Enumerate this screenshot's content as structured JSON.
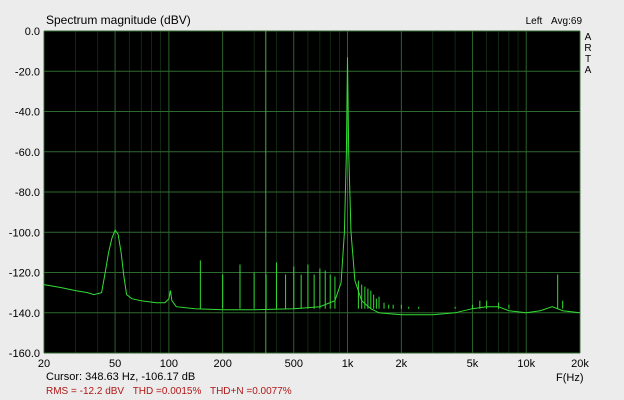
{
  "window": {
    "title": "Spectrum magnitude (dBV)",
    "channel": "Left",
    "averaging": "Avg:69",
    "vertical_label": "ARTA"
  },
  "readouts": {
    "cursor": "Cursor: 348.63 Hz, -106.17 dB",
    "rms": "RMS =  -12.2 dBV",
    "thd": "THD =0.0015%",
    "thdn": "THD+N =0.0077%"
  },
  "colors": {
    "plot_background": "#000000",
    "grid": "#2f6a2f",
    "trace": "#33dd33",
    "cursor_line": "#40b040",
    "rms_text": "#b01818"
  },
  "chart_data": {
    "type": "line",
    "title": "Spectrum magnitude (dBV)",
    "xlabel": "F(Hz)",
    "ylabel": "",
    "x_scale": "log",
    "xlim": [
      20,
      20000
    ],
    "ylim": [
      -160,
      0
    ],
    "grid": true,
    "y_ticks": [
      0,
      -20,
      -40,
      -60,
      -80,
      -100,
      -120,
      -140,
      -160
    ],
    "y_tick_labels": [
      "0.0",
      "-20.0",
      "-40.0",
      "-60.0",
      "-80.0",
      "-100.0",
      "-120.0",
      "-140.0",
      "-160.0"
    ],
    "x_ticks": [
      20,
      50,
      100,
      200,
      500,
      1000,
      2000,
      5000,
      10000,
      20000
    ],
    "x_tick_labels": [
      "20",
      "50",
      "100",
      "200",
      "500",
      "1k",
      "2k",
      "5k",
      "10k",
      "20k"
    ],
    "cursor_x": 348.63,
    "noise_floor": [
      [
        20,
        -126
      ],
      [
        25,
        -127.5
      ],
      [
        30,
        -129
      ],
      [
        35,
        -130
      ],
      [
        38,
        -131
      ],
      [
        40,
        -130.5
      ],
      [
        42,
        -130
      ],
      [
        44,
        -120
      ],
      [
        46,
        -110
      ],
      [
        48,
        -103
      ],
      [
        50,
        -99
      ],
      [
        52,
        -101
      ],
      [
        54,
        -110
      ],
      [
        56,
        -122
      ],
      [
        58,
        -131
      ],
      [
        62,
        -133
      ],
      [
        70,
        -134
      ],
      [
        85,
        -135
      ],
      [
        95,
        -135
      ],
      [
        100,
        -133
      ],
      [
        102,
        -129
      ],
      [
        104,
        -134
      ],
      [
        110,
        -137
      ],
      [
        140,
        -138
      ],
      [
        200,
        -138.5
      ],
      [
        300,
        -138.5
      ],
      [
        500,
        -138
      ],
      [
        700,
        -137
      ],
      [
        850,
        -134
      ],
      [
        920,
        -125
      ],
      [
        960,
        -100
      ],
      [
        985,
        -60
      ],
      [
        1000,
        -13
      ],
      [
        1015,
        -60
      ],
      [
        1045,
        -100
      ],
      [
        1100,
        -124
      ],
      [
        1200,
        -134
      ],
      [
        1350,
        -138
      ],
      [
        1500,
        -140
      ],
      [
        2000,
        -141
      ],
      [
        3000,
        -141
      ],
      [
        4000,
        -140
      ],
      [
        5000,
        -138
      ],
      [
        6000,
        -137
      ],
      [
        7000,
        -137
      ],
      [
        8000,
        -139
      ],
      [
        10000,
        -140
      ],
      [
        12000,
        -139
      ],
      [
        14000,
        -137
      ],
      [
        16000,
        -139
      ],
      [
        20000,
        -140
      ]
    ],
    "harmonic_spikes": [
      [
        150,
        -114
      ],
      [
        200,
        -121
      ],
      [
        250,
        -116
      ],
      [
        300,
        -120
      ],
      [
        350,
        -121
      ],
      [
        400,
        -115
      ],
      [
        450,
        -121
      ],
      [
        500,
        -117
      ],
      [
        550,
        -121
      ],
      [
        600,
        -116
      ],
      [
        650,
        -121
      ],
      [
        700,
        -118
      ],
      [
        750,
        -119
      ],
      [
        800,
        -121
      ],
      [
        850,
        -122
      ],
      [
        1150,
        -124
      ],
      [
        1200,
        -126
      ],
      [
        1250,
        -127
      ],
      [
        1300,
        -128
      ],
      [
        1350,
        -129
      ],
      [
        1400,
        -131
      ],
      [
        1450,
        -133
      ],
      [
        1500,
        -132
      ],
      [
        1600,
        -135
      ],
      [
        1700,
        -136
      ],
      [
        1800,
        -136
      ],
      [
        2000,
        -136
      ],
      [
        2200,
        -137
      ],
      [
        2500,
        -137
      ],
      [
        3000,
        -138
      ],
      [
        4000,
        -137
      ],
      [
        5000,
        -136
      ],
      [
        5500,
        -134
      ],
      [
        6000,
        -134
      ],
      [
        7000,
        -135
      ],
      [
        8000,
        -136
      ],
      [
        15000,
        -121
      ],
      [
        16000,
        -134
      ]
    ]
  }
}
